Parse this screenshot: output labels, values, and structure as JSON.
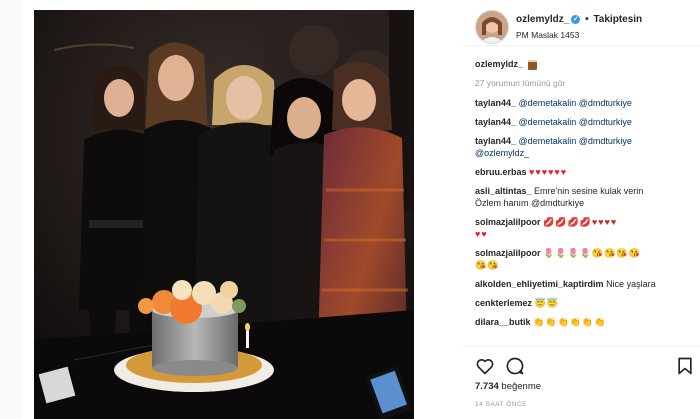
{
  "header": {
    "username": "ozlemyldz_",
    "verified_badge": "✓",
    "separator": "•",
    "follow_label": "Takiptesin",
    "location": "PM Maslak 1453"
  },
  "caption": {
    "username": "ozlemyldz_",
    "emoji": "cake-emoji"
  },
  "view_all_comments": "27 yorumun tümünü gör",
  "comments": [
    {
      "user": "taylan44_",
      "text": "@demetakalin @dmdturkiye"
    },
    {
      "user": "taylan44_",
      "text": "@demetakalin @dmdturkiye"
    },
    {
      "user": "taylan44_",
      "text": "@demetakalin @dmdturkiye",
      "text2": "@ozlemyldz_"
    },
    {
      "user": "ebruu.erbas",
      "text": "♥♥♥♥♥♥"
    },
    {
      "user": "asli_altintas_",
      "text": "Emre'nin sesine kulak verin",
      "text2": "Özlem hanım @dmdturkiye"
    },
    {
      "user": "solmazjalilpoor",
      "text": "💋💋💋💋♥♥♥♥",
      "text2": "♥♥"
    },
    {
      "user": "solmazjalilpoor",
      "text": "🌷🌷🌷🌷😘😘😘😘",
      "text2": "😘😘"
    },
    {
      "user": "alkolden_ehliyetimi_kaptirdim",
      "text": "Nice yaşlara"
    },
    {
      "user": "cenkterlemez",
      "text": "😇😇"
    },
    {
      "user": "dilara__butik",
      "text": "👏👏👏👏👏👏"
    }
  ],
  "footer": {
    "likes_count": "7.734",
    "likes_label": "beğenme",
    "timestamp": "14 SAAT ÖNCE"
  },
  "colors": {
    "accent": "#3897f0",
    "mention": "#003569",
    "heart": "#ed1c24",
    "muted": "#999999"
  }
}
